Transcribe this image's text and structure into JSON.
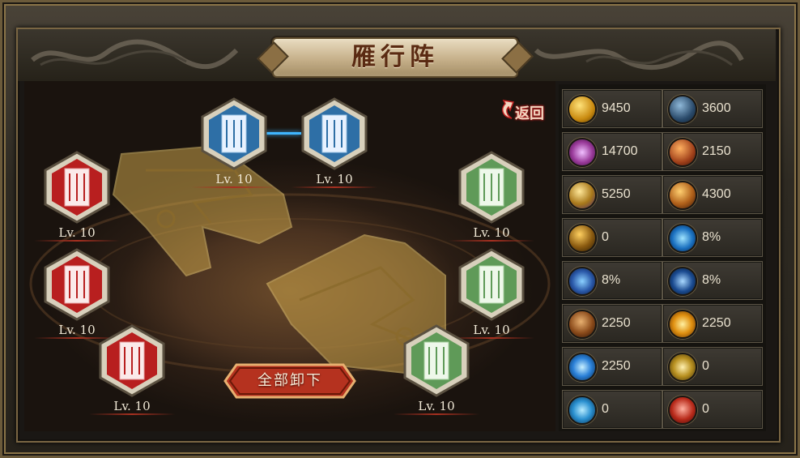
{
  "title": "雁行阵",
  "back_label": "返回",
  "unload_all_label": "全部卸下",
  "colors": {
    "accent_red": "#b5321f",
    "gold": "#c9a24a",
    "blue_card": "#2e6fa6",
    "green_card": "#5f9a58",
    "red_card": "#b81f1f"
  },
  "formation": [
    {
      "slot": "top-left",
      "card": "blue",
      "level": "Lv. 10",
      "icon": "blue-scroll-icon"
    },
    {
      "slot": "top-right",
      "card": "blue",
      "level": "Lv. 10",
      "icon": "blue-scroll-icon"
    },
    {
      "slot": "left-1",
      "card": "red",
      "level": "Lv. 10",
      "icon": "red-scroll-icon"
    },
    {
      "slot": "left-2",
      "card": "red",
      "level": "Lv. 10",
      "icon": "red-scroll-icon"
    },
    {
      "slot": "left-3",
      "card": "red",
      "level": "Lv. 10",
      "icon": "red-scroll-icon"
    },
    {
      "slot": "right-1",
      "card": "green",
      "level": "Lv. 10",
      "icon": "green-scroll-icon"
    },
    {
      "slot": "right-2",
      "card": "green",
      "level": "Lv. 10",
      "icon": "green-scroll-icon"
    },
    {
      "slot": "right-3",
      "card": "green",
      "level": "Lv. 10",
      "icon": "green-scroll-icon"
    }
  ],
  "stats": [
    {
      "icon": "attack-orb-icon",
      "value": "9450"
    },
    {
      "icon": "shield-icon",
      "value": "3600"
    },
    {
      "icon": "health-burst-icon",
      "value": "14700"
    },
    {
      "icon": "warrior-defense-icon",
      "value": "2150"
    },
    {
      "icon": "magic-attack-icon",
      "value": "5250"
    },
    {
      "icon": "magic-defense-icon",
      "value": "4300"
    },
    {
      "icon": "hammer-icon",
      "value": "0"
    },
    {
      "icon": "crit-strike-icon",
      "value": "8%"
    },
    {
      "icon": "dodge-icon",
      "value": "8%"
    },
    {
      "icon": "hit-icon",
      "value": "8%"
    },
    {
      "icon": "beast-icon",
      "value": "2250"
    },
    {
      "icon": "sun-burst-icon",
      "value": "2250"
    },
    {
      "icon": "lightning-icon",
      "value": "2250"
    },
    {
      "icon": "golden-emblem-icon",
      "value": "0"
    },
    {
      "icon": "blue-gem-icon",
      "value": "0"
    },
    {
      "icon": "red-beast-icon",
      "value": "0"
    }
  ]
}
